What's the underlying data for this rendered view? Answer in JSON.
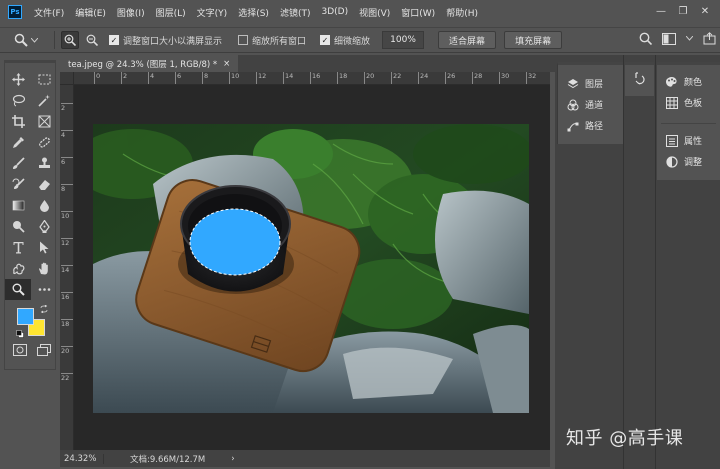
{
  "app": {
    "logo": "Ps"
  },
  "menu": [
    "文件(F)",
    "编辑(E)",
    "图像(I)",
    "图层(L)",
    "文字(Y)",
    "选择(S)",
    "滤镜(T)",
    "3D(D)",
    "视图(V)",
    "窗口(W)",
    "帮助(H)"
  ],
  "window_controls": {
    "minimize": "—",
    "restore": "❐",
    "close": "✕"
  },
  "options": {
    "resize_windows_label": "调整窗口大小以满屏显示",
    "resize_windows_checked": true,
    "zoom_all_label": "缩放所有窗口",
    "zoom_all_checked": false,
    "scrubby_label": "细微缩放",
    "scrubby_checked": true,
    "zoom_value": "100%",
    "fit_screen_label": "适合屏幕",
    "fill_screen_label": "填充屏幕"
  },
  "document": {
    "tab_title": "tea.jpeg @ 24.3% (图层 1, RGB/8) *",
    "close_glyph": "×"
  },
  "status": {
    "zoom": "24.32%",
    "doc_info": "文档:9.66M/12.7M",
    "arrow": "›"
  },
  "ruler": {
    "h_ticks": [
      "0",
      "2",
      "4",
      "6",
      "8",
      "10",
      "12",
      "14",
      "16",
      "18",
      "20",
      "22",
      "24",
      "26",
      "28",
      "30",
      "32"
    ],
    "v_ticks": [
      "2",
      "4",
      "6",
      "8",
      "10",
      "12",
      "14",
      "16",
      "18",
      "20",
      "22"
    ]
  },
  "colors": {
    "foreground": "#31a8ff",
    "background": "#ffe531",
    "selection_fill": "#31a8ff"
  },
  "panels": {
    "group1": [
      {
        "icon": "layers-icon",
        "label": "图层"
      },
      {
        "icon": "channels-icon",
        "label": "通道"
      },
      {
        "icon": "paths-icon",
        "label": "路径"
      }
    ],
    "group3a": [
      {
        "icon": "color-icon",
        "label": "颜色"
      },
      {
        "icon": "swatches-icon",
        "label": "色板"
      }
    ],
    "group3b": [
      {
        "icon": "properties-icon",
        "label": "属性"
      },
      {
        "icon": "adjustments-icon",
        "label": "调整"
      }
    ]
  },
  "watermark": "知乎 @高手课"
}
